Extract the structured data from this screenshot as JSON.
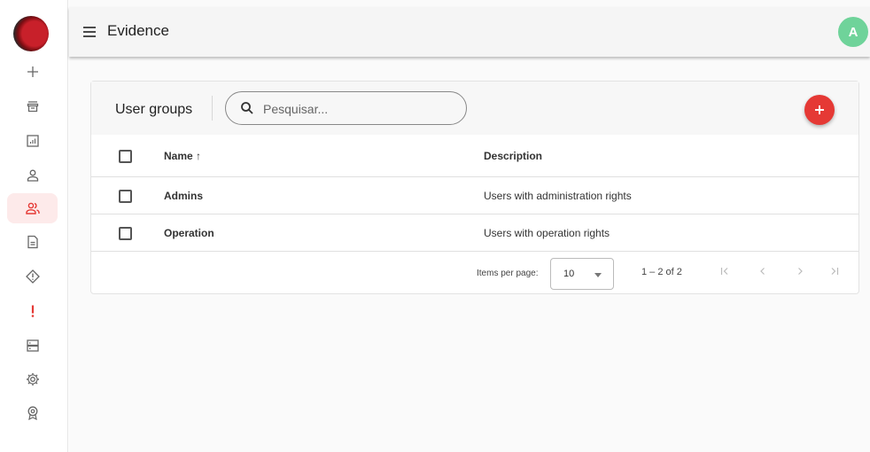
{
  "sidebar": {
    "items": [
      {
        "icon": "plus-icon",
        "active": false
      },
      {
        "icon": "archive-icon",
        "active": false
      },
      {
        "icon": "report-chart-icon",
        "active": false
      },
      {
        "icon": "user-icon",
        "active": false
      },
      {
        "icon": "user-group-icon",
        "active": true
      },
      {
        "icon": "document-icon",
        "active": false
      },
      {
        "icon": "warning-diamond-icon",
        "active": false
      },
      {
        "icon": "exclamation-icon",
        "active": false
      },
      {
        "icon": "server-icon",
        "active": false
      },
      {
        "icon": "gear-icon",
        "active": false
      },
      {
        "icon": "badge-icon",
        "active": false
      }
    ],
    "accent_color": "#e53935"
  },
  "header": {
    "title": "Evidence",
    "avatar_initial": "A",
    "avatar_color": "#6fd39a"
  },
  "card": {
    "title": "User groups",
    "search_placeholder": "Pesquisar...",
    "add_button_color": "#e53935"
  },
  "table": {
    "columns": {
      "name": "Name ↑",
      "description": "Description"
    },
    "rows": [
      {
        "name": "Admins",
        "description": "Users with administration rights"
      },
      {
        "name": "Operation",
        "description": "Users with operation rights"
      }
    ]
  },
  "paginator": {
    "items_per_page_label": "Items per page:",
    "page_size": "10",
    "range_label": "1 – 2 of 2"
  }
}
